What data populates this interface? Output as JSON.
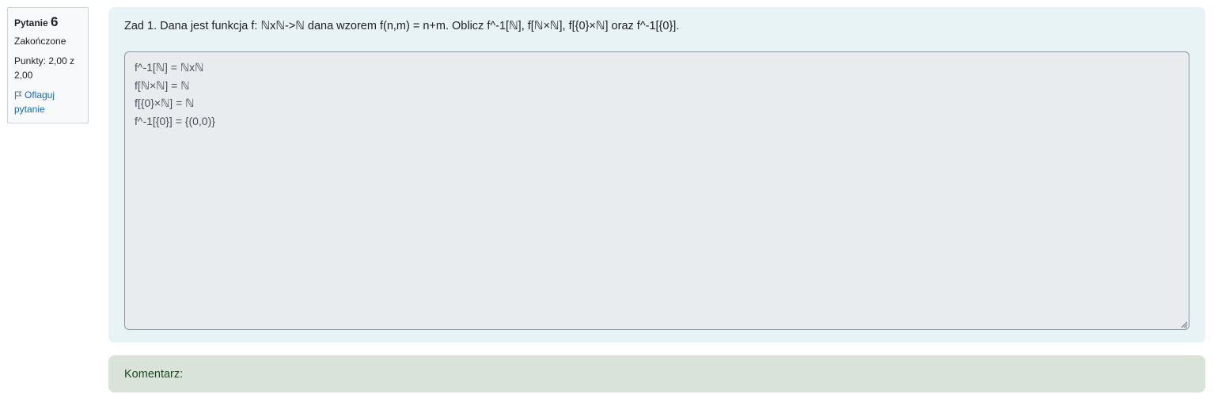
{
  "info": {
    "question_label": "Pytanie",
    "question_number": "6",
    "state": "Zakończone",
    "grade": "Punkty: 2,00 z 2,00",
    "flag_icon": "flag-icon",
    "flag_label": "Oflaguj pytanie"
  },
  "question": {
    "text": "Zad 1. Dana jest funkcja f: ℕxℕ->ℕ dana wzorem f(n,m) = n+m. Oblicz f^-1[ℕ], f[ℕ×ℕ], f[{0}×ℕ] oraz f^-1[{0}].",
    "answer": "f^-1[ℕ] = ℕxℕ\nf[ℕ×ℕ] = ℕ\nf[{0}×ℕ] = ℕ\nf^-1[{0}] = {(0,0)}"
  },
  "comment": {
    "label": "Komentarz:"
  },
  "colors": {
    "formulation_bg": "#e7f3f5",
    "comment_bg": "#d9e3da",
    "link": "#0f6cbf"
  }
}
